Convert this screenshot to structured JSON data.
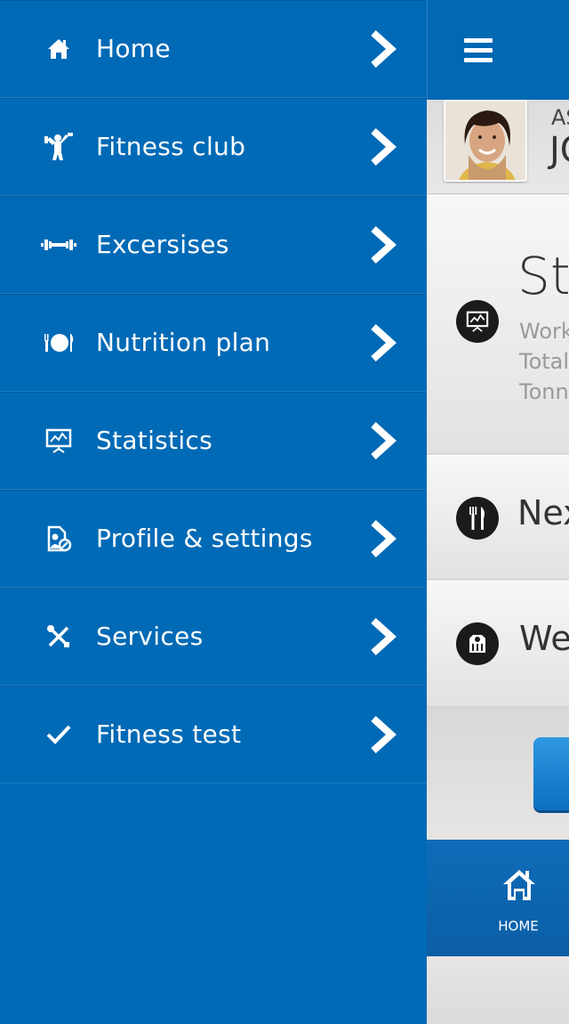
{
  "menu": {
    "items": [
      {
        "label": "Home",
        "icon": "home-icon"
      },
      {
        "label": "Fitness club",
        "icon": "fitness-club-icon"
      },
      {
        "label": "Excersises",
        "icon": "dumbbell-icon"
      },
      {
        "label": "Nutrition plan",
        "icon": "plate-icon"
      },
      {
        "label": "Statistics",
        "icon": "statistics-icon"
      },
      {
        "label": "Profile & settings",
        "icon": "profile-settings-icon"
      },
      {
        "label": "Services",
        "icon": "tools-icon"
      },
      {
        "label": "Fitness test",
        "icon": "checkmark-icon"
      }
    ]
  },
  "profile": {
    "name_line1": "AS",
    "name_line2": "JO"
  },
  "stats_card": {
    "title": "Sta",
    "lines": [
      "Work",
      "Total",
      "Tonn"
    ]
  },
  "next_card": {
    "label": "Nex"
  },
  "weight_card": {
    "label": "We"
  },
  "tabbar": {
    "home_label": "HOME"
  },
  "colors": {
    "menu_bg": "#006ab6",
    "topbar_bg": "#0168b4",
    "content_bg": "#e4e3e2",
    "icon_circle": "#1b1b1b"
  }
}
